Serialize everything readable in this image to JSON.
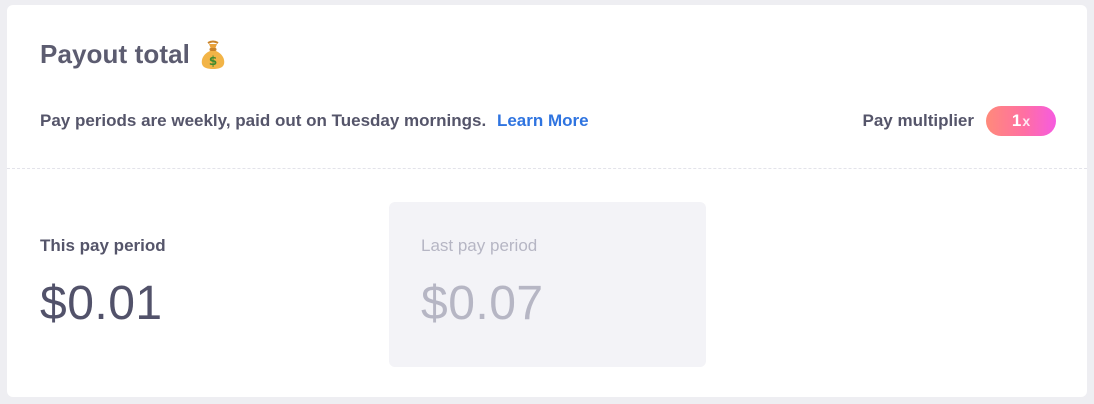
{
  "header": {
    "title": "Payout total",
    "title_icon": "money-bag-icon",
    "info_text": "Pay periods are weekly, paid out on Tuesday mornings.",
    "learn_more_label": "Learn More"
  },
  "multiplier": {
    "label": "Pay multiplier",
    "value": "1",
    "suffix": "x"
  },
  "periods": {
    "current": {
      "label": "This pay period",
      "amount": "$0.01"
    },
    "last": {
      "label": "Last pay period",
      "amount": "$0.07"
    }
  },
  "colors": {
    "link": "#2f74e0",
    "text": "#55556a",
    "muted": "#b6b6c4",
    "badge_gradient_start": "#ff8a7a",
    "badge_gradient_end": "#f65be0"
  }
}
